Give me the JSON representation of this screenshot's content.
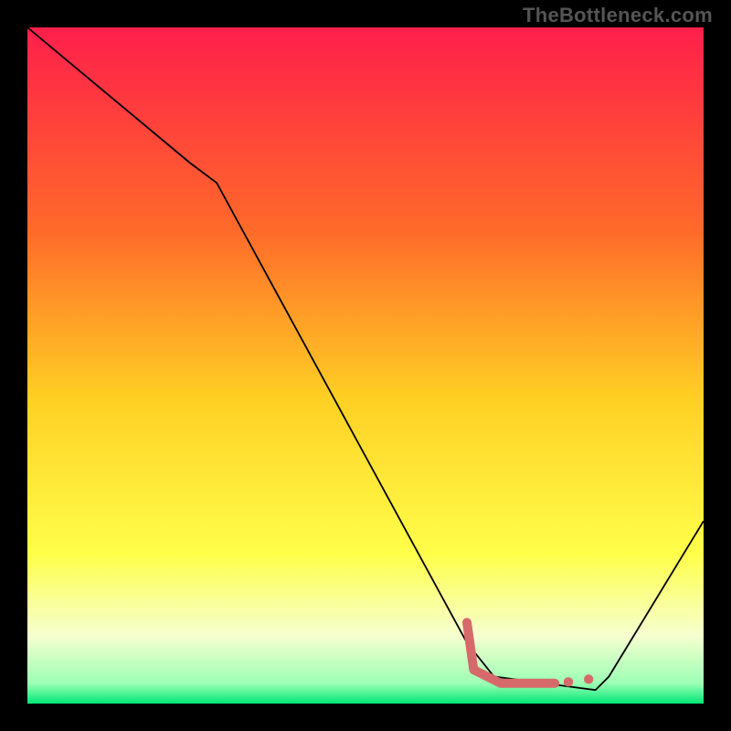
{
  "watermark": "TheBottleneck.com",
  "chart_data": {
    "type": "line",
    "title": "",
    "xlabel": "",
    "ylabel": "",
    "xlim": [
      0,
      100
    ],
    "ylim": [
      0,
      100
    ],
    "gradient_stops": [
      {
        "offset": 0,
        "color": "#ff1f4b"
      },
      {
        "offset": 30,
        "color": "#ff6a2a"
      },
      {
        "offset": 55,
        "color": "#ffd024"
      },
      {
        "offset": 78,
        "color": "#ffff4a"
      },
      {
        "offset": 90,
        "color": "#f6ffd0"
      },
      {
        "offset": 97,
        "color": "#9cffb4"
      },
      {
        "offset": 100,
        "color": "#00e676"
      }
    ],
    "series": [
      {
        "name": "bottleneck-curve",
        "style": "line",
        "color": "#000000",
        "x": [
          0,
          24,
          28,
          65,
          69,
          84,
          86,
          100
        ],
        "values": [
          100,
          80,
          77,
          9,
          4,
          2,
          4,
          27
        ]
      },
      {
        "name": "optimal-marker",
        "style": "dotted-thick",
        "color": "#d66a6a",
        "x": [
          65,
          66,
          70,
          78,
          80,
          83
        ],
        "values": [
          12,
          5,
          3,
          3,
          3.2,
          3.6
        ]
      }
    ]
  }
}
